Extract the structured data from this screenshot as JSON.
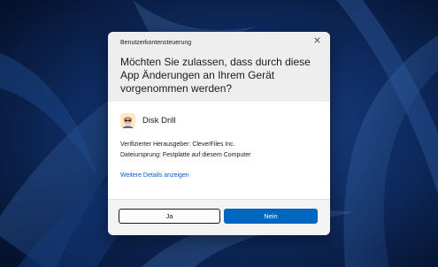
{
  "dialog": {
    "caption": "Benutzerkontensteuerung",
    "question": "Möchten Sie zulassen, dass durch diese App Änderungen an Ihrem Gerät vorgenommen werden?",
    "close_icon": "close-icon",
    "app": {
      "name": "Disk Drill",
      "icon": "disk-drill-app-icon"
    },
    "publisher": "Verifizierter Herausgeber: CleverFiles Inc.",
    "origin": "Dateiursprung: Festplatte auf diesem Computer",
    "details_link": "Weitere Details anzeigen",
    "buttons": {
      "yes": "Ja",
      "no": "Nein"
    },
    "colors": {
      "primary_button": "#0067c0",
      "link": "#0a5ac2",
      "header_background": "#eeeeee",
      "footer_background": "#f3f3f3"
    }
  }
}
